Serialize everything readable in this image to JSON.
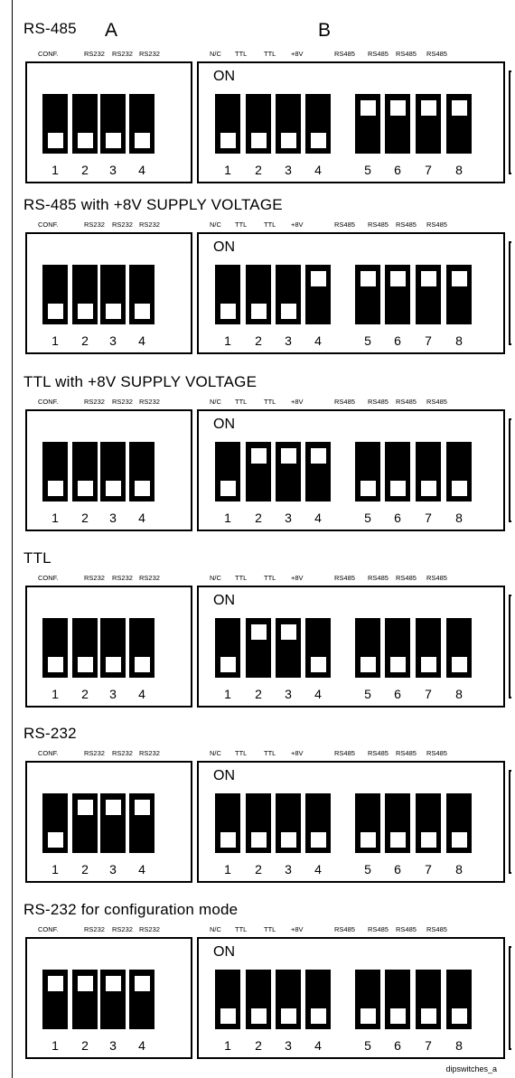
{
  "header_letters": {
    "a": "A",
    "b": "B"
  },
  "labels_a": [
    "CONF.",
    "RS232",
    "RS232",
    "RS232"
  ],
  "labels_b": [
    "N/C",
    "TTL",
    "TTL",
    "+8V",
    "RS485",
    "RS485",
    "RS485",
    "RS485"
  ],
  "numbers_a": [
    "1",
    "2",
    "3",
    "4"
  ],
  "numbers_b": [
    "1",
    "2",
    "3",
    "4",
    "5",
    "6",
    "7",
    "8"
  ],
  "on_label": "ON",
  "sections": [
    {
      "title": "RS-485",
      "a": [
        "down",
        "down",
        "down",
        "down"
      ],
      "b": [
        "down",
        "down",
        "down",
        "down",
        "up",
        "up",
        "up",
        "up"
      ]
    },
    {
      "title": "RS-485 with +8V SUPPLY VOLTAGE",
      "a": [
        "down",
        "down",
        "down",
        "down"
      ],
      "b": [
        "down",
        "down",
        "down",
        "up",
        "up",
        "up",
        "up",
        "up"
      ]
    },
    {
      "title": "TTL with +8V SUPPLY VOLTAGE",
      "a": [
        "down",
        "down",
        "down",
        "down"
      ],
      "b": [
        "down",
        "up",
        "up",
        "up",
        "down",
        "down",
        "down",
        "down"
      ]
    },
    {
      "title": "TTL",
      "a": [
        "down",
        "down",
        "down",
        "down"
      ],
      "b": [
        "down",
        "up",
        "up",
        "down",
        "down",
        "down",
        "down",
        "down"
      ]
    },
    {
      "title": "RS-232",
      "a": [
        "down",
        "up",
        "up",
        "up"
      ],
      "b": [
        "down",
        "down",
        "down",
        "down",
        "down",
        "down",
        "down",
        "down"
      ]
    },
    {
      "title": "RS-232 for configuration mode",
      "a": [
        "up",
        "up",
        "up",
        "up"
      ],
      "b": [
        "down",
        "down",
        "down",
        "down",
        "down",
        "down",
        "down",
        "down"
      ]
    }
  ],
  "footer": "dipswitches_a"
}
